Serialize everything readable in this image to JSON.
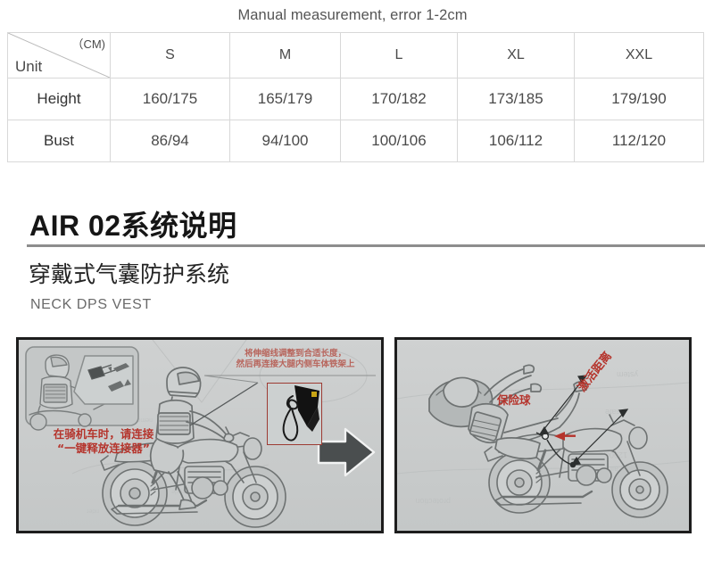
{
  "caption": "Manual measurement, error 1-2cm",
  "size_table": {
    "corner": {
      "unit_label": "Unit",
      "cm_label": "（CM)"
    },
    "columns": [
      "S",
      "M",
      "L",
      "XL",
      "XXL"
    ],
    "rows": [
      {
        "label": "Height",
        "values": [
          "160/175",
          "165/179",
          "170/182",
          "173/185",
          "179/190"
        ]
      },
      {
        "label": "Bust",
        "values": [
          "86/94",
          "94/100",
          "100/106",
          "106/112",
          "112/120"
        ]
      }
    ]
  },
  "headings": {
    "main": "AIR 02系统说明",
    "sub": "穿戴式气囊防护系统",
    "english": "NECK DPS VEST"
  },
  "panels": {
    "left": {
      "note_inset": "在骑机车时，请连接\n“一键释放连接器”",
      "note_inset_line1": "在骑机车时，请连接",
      "note_inset_line2": "“一键释放连接器”",
      "note_top_line1": "将伸缩线调整到合适长度，",
      "note_top_line2": "然后再连接大腿内侧车体铁架上",
      "arrow": "right-arrow"
    },
    "right": {
      "label_activate": "激活距离",
      "label_ball": "保险球"
    }
  },
  "colors": {
    "red_annotation": "#b5342c",
    "panel_border": "#1d1d1d",
    "panel_background": "#c9cbcb",
    "table_border": "#d8d8d8",
    "text": "#4a4a4a",
    "heading": "#161616",
    "rule": "#8d8d8d"
  }
}
